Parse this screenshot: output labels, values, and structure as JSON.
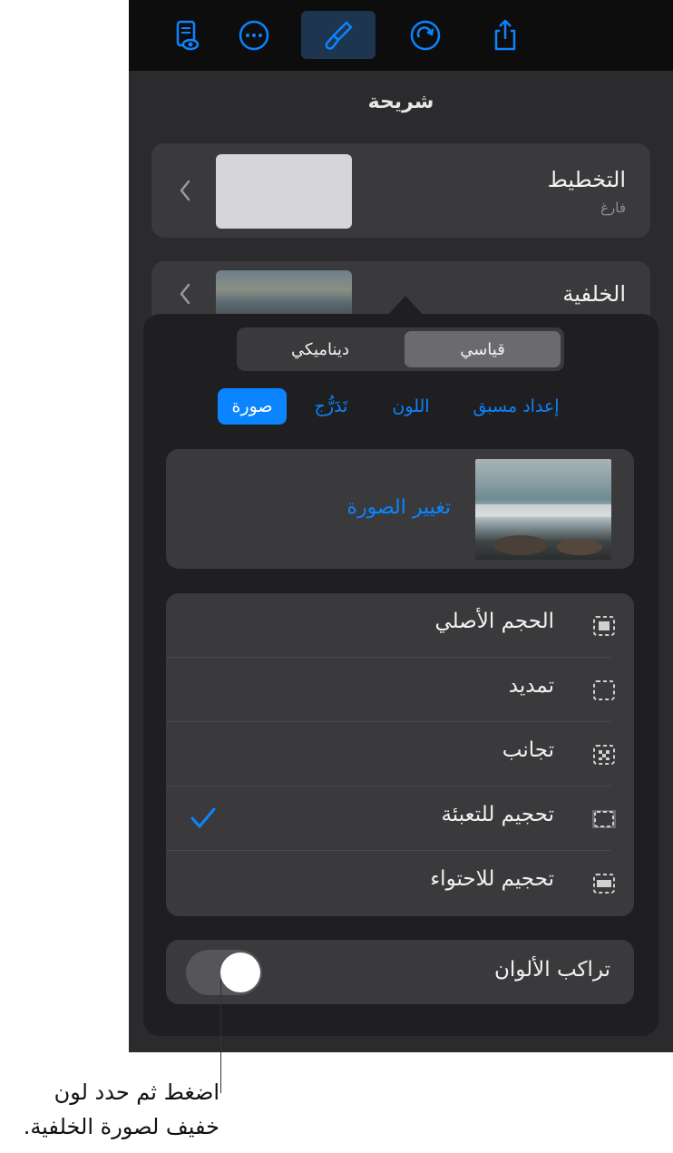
{
  "toolbar": {
    "buttons": [
      {
        "name": "document-view-icon"
      },
      {
        "name": "more-icon"
      },
      {
        "name": "format-brush-icon",
        "active": true
      },
      {
        "name": "undo-redo-icon"
      },
      {
        "name": "share-icon"
      }
    ],
    "accent": "#0a84ff"
  },
  "panel_title": "شريحة",
  "layout": {
    "label": "التخطيط",
    "value": "فارغ"
  },
  "background": {
    "label": "الخلفية"
  },
  "segment": {
    "standard": "قياسي",
    "dynamic": "ديناميكي",
    "selected": "standard"
  },
  "fill_tabs": {
    "preset": "إعداد مسبق",
    "color": "اللون",
    "gradient": "تَدَرُّج",
    "image": "صورة",
    "selected": "image"
  },
  "change_image": "تغيير الصورة",
  "scale_options": [
    {
      "label": "الحجم الأصلي",
      "icon": "original-size-icon",
      "checked": false
    },
    {
      "label": "تمديد",
      "icon": "stretch-icon",
      "checked": false
    },
    {
      "label": "تجانب",
      "icon": "tile-icon",
      "checked": false
    },
    {
      "label": "تحجيم للتعبئة",
      "icon": "scale-to-fill-icon",
      "checked": true
    },
    {
      "label": "تحجيم للاحتواء",
      "icon": "scale-to-fit-icon",
      "checked": false
    }
  ],
  "color_overlay": {
    "label": "تراكب الألوان",
    "on": false
  },
  "callout": "اضغط ثم حدد لون خفيف لصورة الخلفية."
}
